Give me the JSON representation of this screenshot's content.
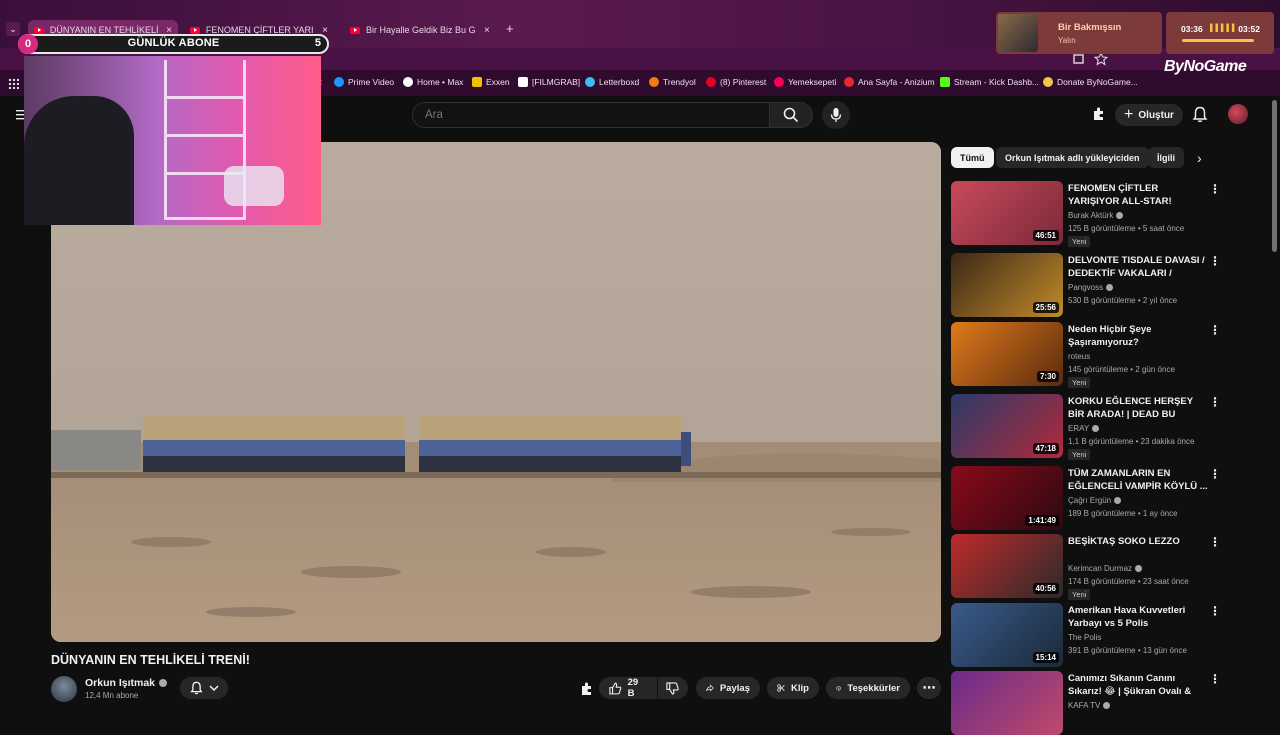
{
  "browser": {
    "tabs": [
      {
        "label": "DÜNYANIN EN TEHLİKELİ TRENİ!",
        "active": true
      },
      {
        "label": "FENOMEN ÇİFTLER YARIŞIYOR ALL-STAR!",
        "active": false
      },
      {
        "label": "Bir Hayalle Geldik Biz Bu Günlere",
        "active": false
      }
    ],
    "close_glyph": "×",
    "new_tab_glyph": "+",
    "bookmarks": [
      {
        "label": "Prime Video",
        "color": "#1a98ff"
      },
      {
        "label": "Home • Max",
        "color": "#ffffff"
      },
      {
        "label": "Exxen",
        "color": "#f2c200"
      },
      {
        "label": "[FILMGRAB]",
        "color": "#ffffff"
      },
      {
        "label": "Letterboxd",
        "color": "#40bcf4"
      },
      {
        "label": "Trendyol",
        "color": "#f27a1a"
      },
      {
        "label": "(8) Pinterest",
        "color": "#e60023"
      },
      {
        "label": "Yemeksepeti",
        "color": "#fa0050"
      },
      {
        "label": "Ana Sayfa - Anizium",
        "color": "#e32b2b"
      },
      {
        "label": "Stream - Kick Dashb...",
        "color": "#53fc18"
      },
      {
        "label": "Donate ByNoGame...",
        "color": "#f6c244"
      }
    ]
  },
  "overlay": {
    "subscriber_goal": {
      "left": "0",
      "label": "GÜNLÜK ABONE",
      "right": "5"
    },
    "music": {
      "title": "Bir Bakmışsın",
      "artist": "Yalın"
    },
    "timer": {
      "current": "03:36",
      "total": "03:52",
      "bars": "▌▌▌▌▌"
    },
    "brand": "ByNoGame"
  },
  "youtube": {
    "search_placeholder": "Ara",
    "create_label": "Oluştur",
    "video": {
      "title": "DÜNYANIN EN TEHLİKELİ TRENİ!",
      "channel": "Orkun Işıtmak",
      "subscribers": "12,4 Mn abone",
      "likes": "29 B",
      "share_label": "Paylaş",
      "clip_label": "Klip",
      "thanks_label": "Teşekkürler"
    },
    "chips": [
      {
        "label": "Tümü",
        "active": true
      },
      {
        "label": "Orkun Işıtmak adlı yükleyiciden",
        "active": false
      },
      {
        "label": "İlgili",
        "active": false
      }
    ],
    "recommendations": [
      {
        "title": "FENOMEN ÇİFTLER YARIŞIYOR ALL-STAR! (SEVGİLİLER GÜNÜ...",
        "channel": "Burak Aktürk",
        "verified": true,
        "views": "125 B görüntüleme",
        "age": "5 saat önce",
        "duration": "46:51",
        "badge": "Yeni",
        "thumb_colors": [
          "#c9485a",
          "#7a2a3a"
        ]
      },
      {
        "title": "DELVONTE TISDALE DAVASI / DEDEKTİF VAKALARI /",
        "channel": "Pangvoss",
        "verified": true,
        "views": "530 B görüntüleme",
        "age": "2 yıl önce",
        "duration": "25:56",
        "badge": "",
        "thumb_colors": [
          "#3a2818",
          "#c28a2a"
        ]
      },
      {
        "title": "Neden Hiçbir Şeye Şaşıramıyoruz?",
        "channel": "roteus",
        "verified": false,
        "views": "145 görüntüleme",
        "age": "2 gün önce",
        "duration": "7:30",
        "badge": "Yeni",
        "thumb_colors": [
          "#e07a1a",
          "#5a2a10"
        ]
      },
      {
        "title": "KORKU EĞLENCE HERŞEY BİR ARADA! | DEAD BU DAYLIGHT ...",
        "channel": "ERAY",
        "verified": true,
        "views": "1,1 B görüntüleme",
        "age": "23 dakika önce",
        "duration": "47:18",
        "badge": "Yeni",
        "thumb_colors": [
          "#2a3a6a",
          "#b02a3a"
        ]
      },
      {
        "title": "TÜM ZAMANLARIN EN EĞLENCELİ VAMPİR KÖYLÜ ...",
        "channel": "Çağrı Ergün",
        "verified": true,
        "views": "189 B görüntüleme",
        "age": "1 ay önce",
        "duration": "1:41:49",
        "badge": "",
        "thumb_colors": [
          "#8a0a1a",
          "#2a0a10"
        ]
      },
      {
        "title": "BEŞİKTAŞ SOKO LEZZO",
        "channel": "Kerimcan Durmaz",
        "verified": true,
        "views": "174 B görüntüleme",
        "age": "23 saat önce",
        "duration": "40:56",
        "badge": "Yeni",
        "thumb_colors": [
          "#c02a2a",
          "#2a2a2a"
        ]
      },
      {
        "title": "Amerikan Hava Kuvvetleri Yarbayı vs 5 Polis",
        "channel": "The Polis",
        "verified": false,
        "views": "391 B görüntüleme",
        "age": "13 gün önce",
        "duration": "15:14",
        "badge": "",
        "thumb_colors": [
          "#3a5a8a",
          "#1a2a3a"
        ]
      },
      {
        "title": "Canımızı Sıkanın Canını Sıkarız! 😂 | Şükran Ovalı & Caner Erki...",
        "channel": "KAFA TV",
        "verified": true,
        "views": "",
        "age": "",
        "duration": "",
        "badge": "",
        "thumb_colors": [
          "#6a2a8a",
          "#c04a6a"
        ]
      }
    ]
  }
}
